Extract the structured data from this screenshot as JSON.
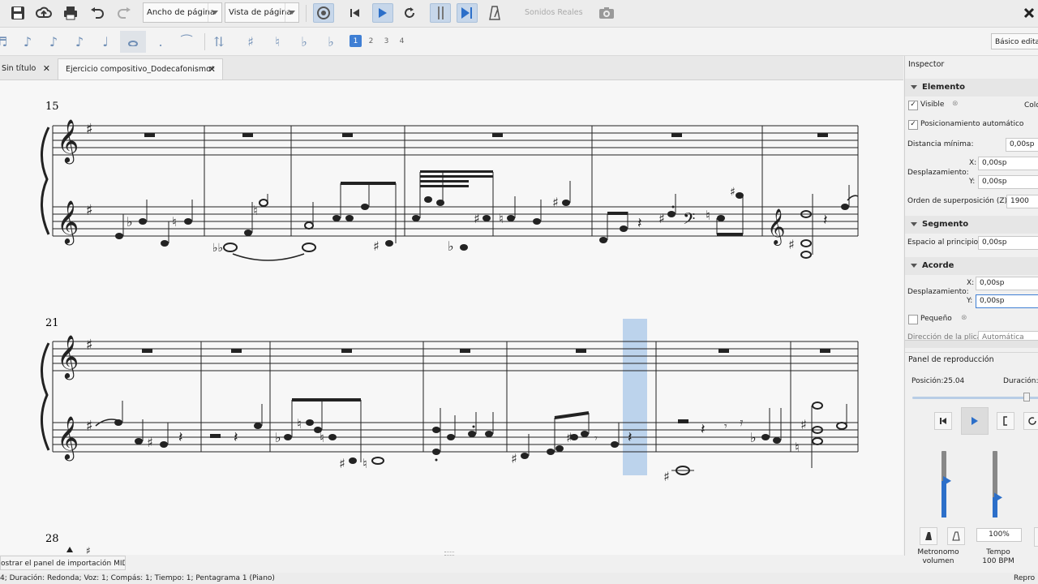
{
  "toolbar": {
    "view_width_combo": "Ancho de página",
    "view_mode_combo": "Vista de página",
    "real_sounds": "Sonidos Reales",
    "workspace_combo": "Básico editar",
    "voices": [
      "1",
      "2",
      "3",
      "4"
    ],
    "icons": [
      "save-icon",
      "cloud-upload-icon",
      "print-icon",
      "undo-icon",
      "redo-icon",
      "mixer-icon",
      "rewind-icon",
      "play-icon",
      "loop-icon",
      "loop-in-icon",
      "loop-out-icon",
      "metronome-icon",
      "camera-icon"
    ]
  },
  "tabs": [
    {
      "label": "Sin título"
    },
    {
      "label": "Ejercicio compositivo_Dodecafonismo*"
    }
  ],
  "score": {
    "measure_numbers": [
      "15",
      "21",
      "28"
    ],
    "selection_color": "#bcd3ec"
  },
  "inspector": {
    "title": "Inspector",
    "element": {
      "header": "Elemento",
      "visible_label": "Visible",
      "color_label": "Colo",
      "autoplace_label": "Posicionamiento automático",
      "min_distance_label": "Distancia mínima:",
      "min_distance_value": "0,00sp",
      "offset_label": "Desplazamiento:",
      "x_label": "X:",
      "x_value": "0,00sp",
      "y_label": "Y:",
      "y_value": "0,00sp",
      "z_order_label": "Orden de superposición (Z):",
      "z_order_value": "1900"
    },
    "segment": {
      "header": "Segmento",
      "leading_space_label": "Espacio al principio:",
      "leading_space_value": "0,00sp"
    },
    "chord": {
      "header": "Acorde",
      "offset_label": "Desplazamiento:",
      "x_label": "X:",
      "x_value": "0,00sp",
      "y_label": "Y:",
      "y_value": "0,00sp",
      "small_label": "Pequeño",
      "stem_direction_label": "Dirección de la plica:",
      "stem_direction_value": "Automática"
    }
  },
  "playback": {
    "title": "Panel de reproducción",
    "position_label": "Posición:",
    "position_value": "25.04",
    "duration_label": "Duración:",
    "slider_fraction": 0.88,
    "metronome_volume_fraction": 0.55,
    "tempo_fraction": 0.3,
    "tempo_percent": "100%",
    "metronome_label_1": "Metronomo",
    "metronome_label_2": "volumen",
    "tempo_label_1": "Tempo",
    "tempo_label_2": "100 BPM"
  },
  "midi_button": "ostrar el panel de importación MIDI",
  "status_text": "4; Duración: Redonda; Voz: 1;  Compás: 1; Tiempo: 1; Pentagrama 1 (Piano)",
  "status_right": "Repro"
}
